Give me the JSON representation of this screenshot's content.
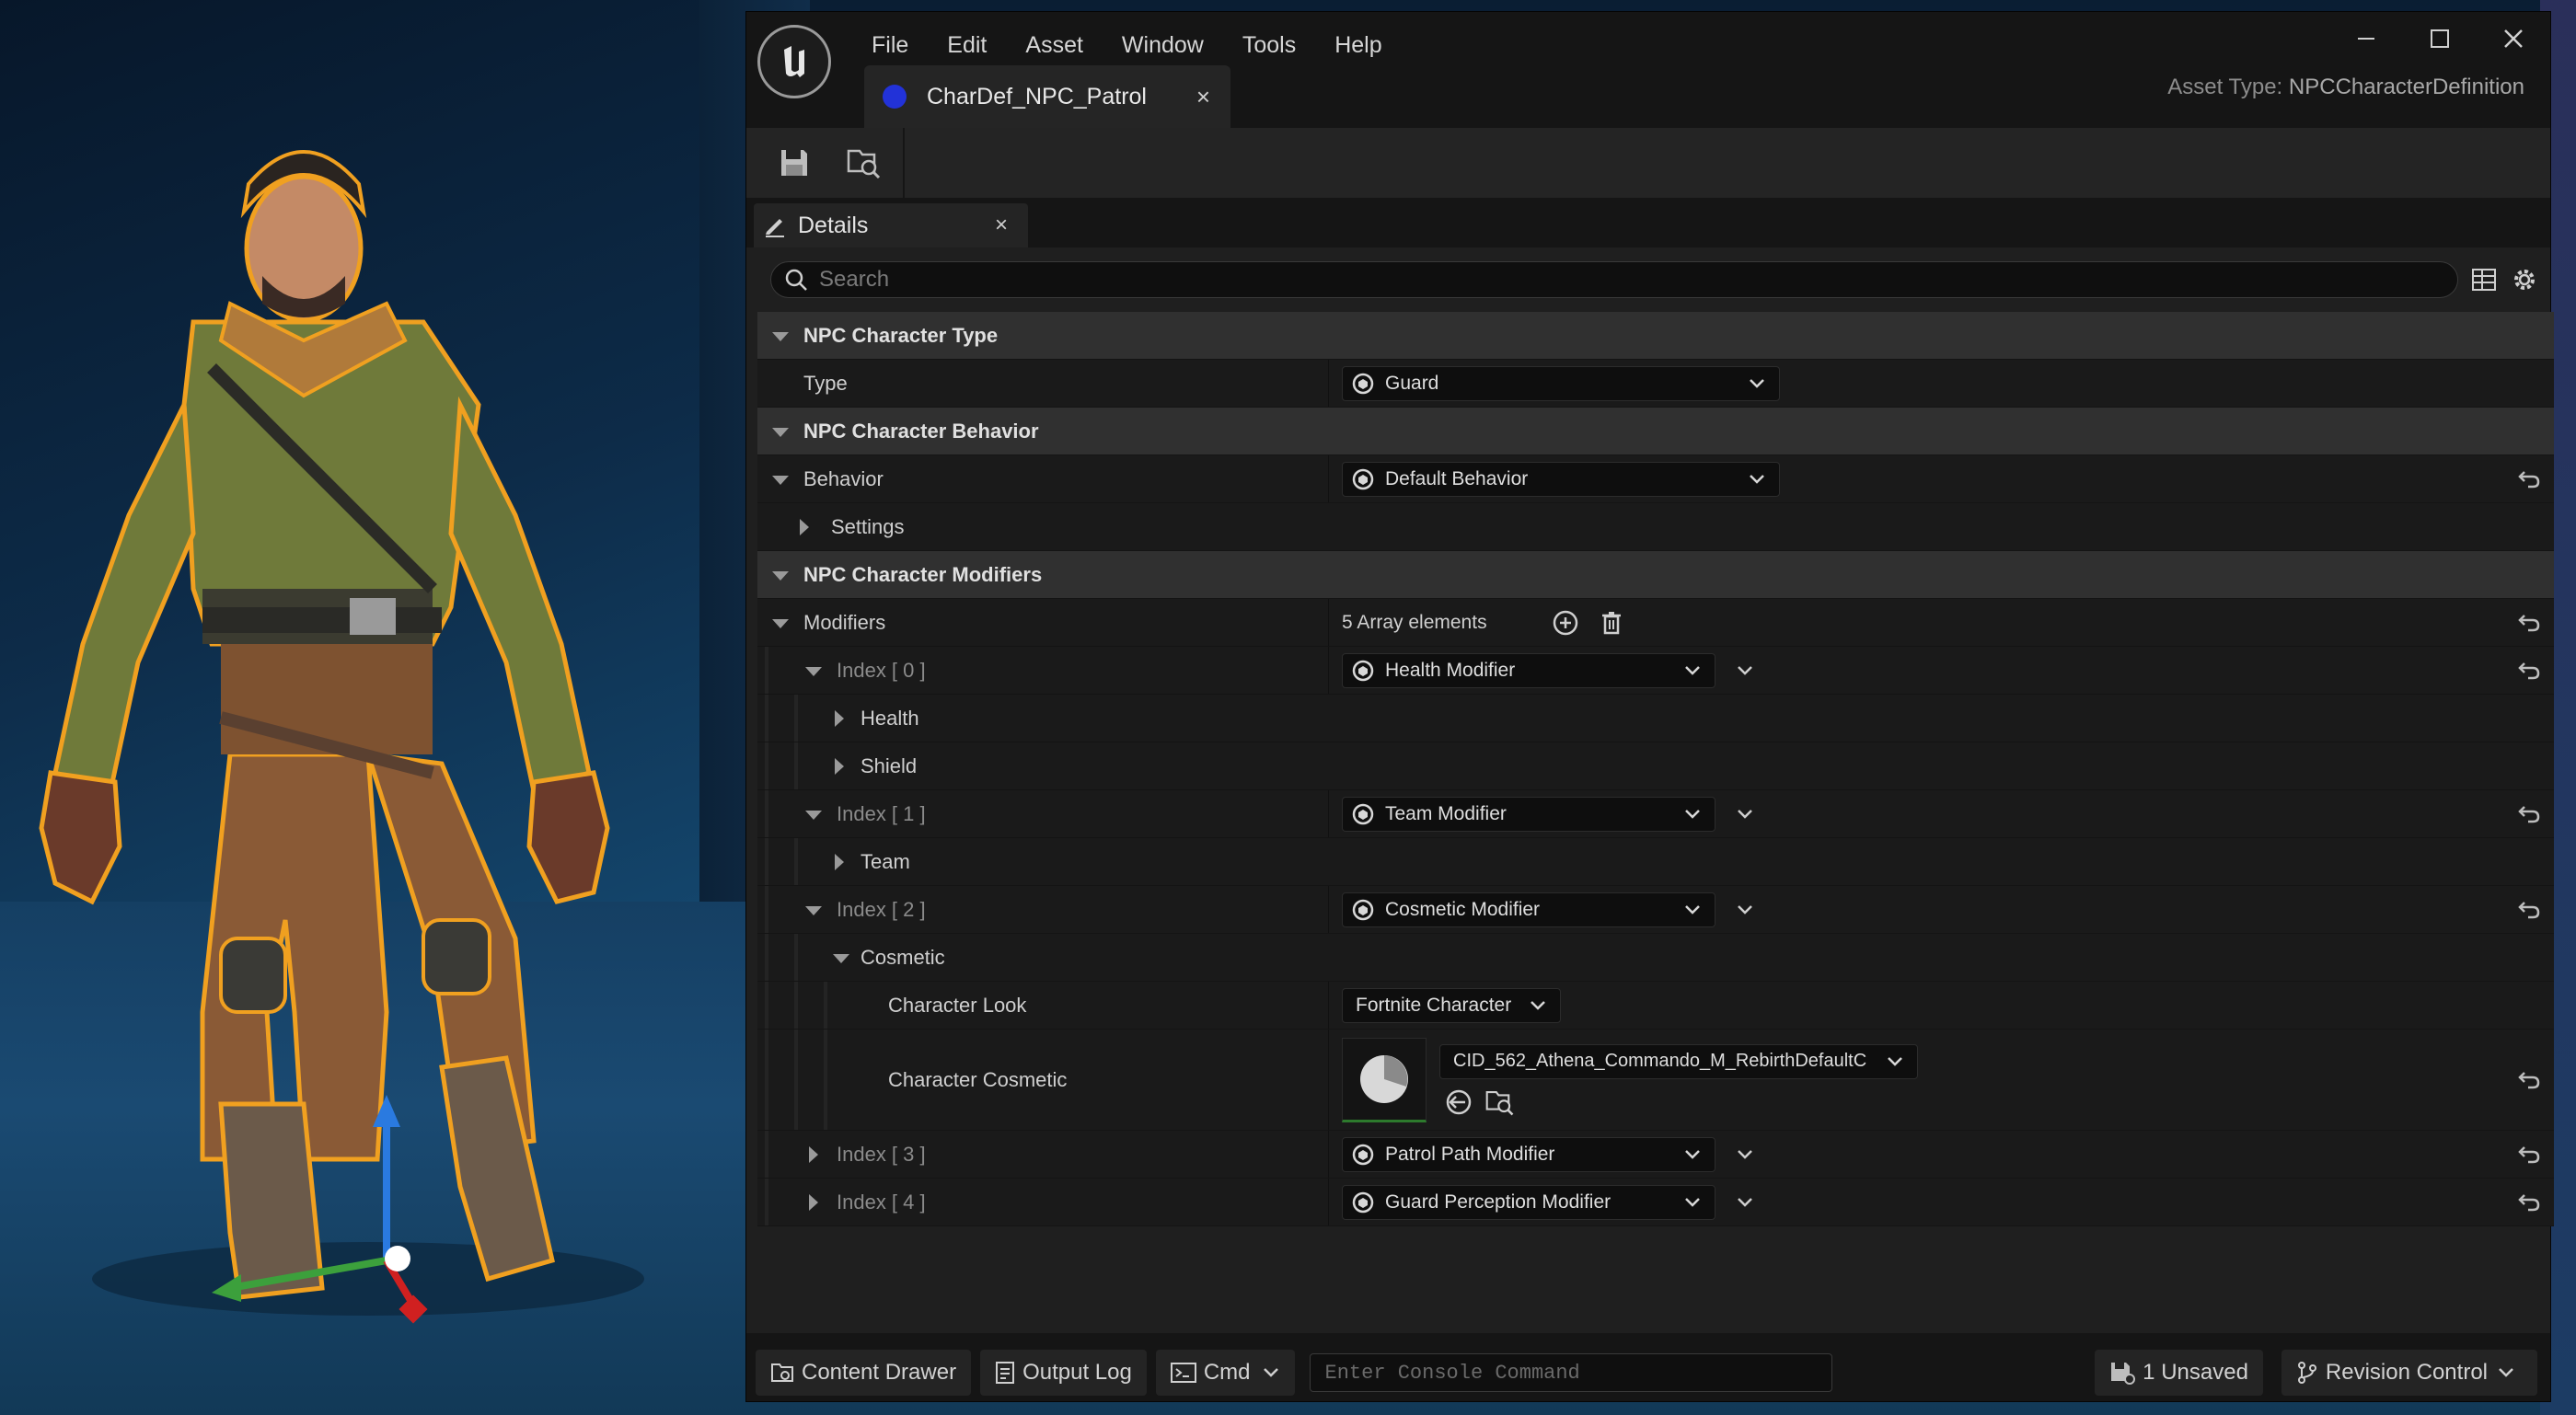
{
  "menubar": {
    "items": [
      "File",
      "Edit",
      "Asset",
      "Window",
      "Tools",
      "Help"
    ]
  },
  "document_tab": {
    "label": "CharDef_NPC_Patrol",
    "close": "×",
    "color": "#2232d8"
  },
  "asset_type": {
    "label": "Asset Type:",
    "value": "NPCCharacterDefinition"
  },
  "details_tab": {
    "label": "Details",
    "close": "×"
  },
  "search": {
    "placeholder": "Search"
  },
  "categories": {
    "type": "NPC Character Type",
    "behavior": "NPC Character Behavior",
    "modifiers": "NPC Character Modifiers"
  },
  "rows": {
    "type_name": "Type",
    "type_value": "Guard",
    "behavior_name": "Behavior",
    "behavior_value": "Default Behavior",
    "settings_name": "Settings",
    "modifiers_name": "Modifiers",
    "modifiers_count": "5 Array elements",
    "index0_name": "Index [ 0 ]",
    "index0_value": "Health Modifier",
    "health_name": "Health",
    "shield_name": "Shield",
    "index1_name": "Index [ 1 ]",
    "index1_value": "Team Modifier",
    "team_name": "Team",
    "index2_name": "Index [ 2 ]",
    "index2_value": "Cosmetic Modifier",
    "cosmetic_name": "Cosmetic",
    "look_name": "Character Look",
    "look_value": "Fortnite Character",
    "cosmetic_char_name": "Character Cosmetic",
    "cosmetic_char_value": "CID_562_Athena_Commando_M_RebirthDefaultC",
    "index3_name": "Index [ 3 ]",
    "index3_value": "Patrol Path Modifier",
    "index4_name": "Index [ 4 ]",
    "index4_value": "Guard Perception Modifier"
  },
  "statusbar": {
    "content_drawer": "Content Drawer",
    "output_log": "Output Log",
    "cmd": "Cmd",
    "console_placeholder": "Enter Console Command",
    "unsaved": "1 Unsaved",
    "revision_control": "Revision Control"
  },
  "colors": {
    "accent_outline": "#f0a020",
    "window_bg": "#151515",
    "panel_bg": "#1f1f1f",
    "category_bg": "#303030"
  },
  "icons": [
    "unreal-logo-icon",
    "save-icon",
    "browse-asset-icon",
    "search-icon",
    "table-view-icon",
    "gear-icon",
    "reset-arrow-icon",
    "add-element-icon",
    "delete-icon",
    "chevron-down-icon"
  ]
}
